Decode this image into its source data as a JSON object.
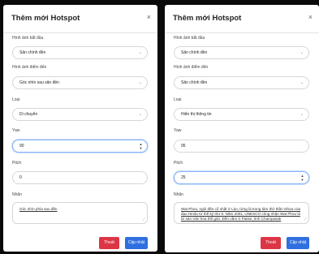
{
  "left_modal": {
    "title": "Thêm mới Hotspot",
    "close": "×",
    "fields": {
      "start_image_label": "Hình ảnh bắt đầu",
      "start_image_value": "Sân chính đền",
      "end_image_label": "Hình ảnh điểm đến",
      "end_image_value": "Góc nhìn sau sân đền",
      "type_label": "Loại",
      "type_value": "Di chuyển",
      "yaw_label": "Yaw",
      "yaw_value": "90",
      "pitch_label": "Pitch",
      "pitch_value": "0",
      "note_label": "Nhãn",
      "note_value": "Góc nhìn phía sau đền"
    },
    "buttons": {
      "cancel": "Thoát",
      "save": "Cập nhật"
    }
  },
  "right_modal": {
    "title": "Thêm mới Hotspot",
    "close": "×",
    "fields": {
      "start_image_label": "Hình ảnh bắt đầu",
      "start_image_value": "Sân chính đền",
      "end_image_label": "Hình ảnh điểm đến",
      "end_image_value": "Sân chính đền",
      "type_label": "Loại",
      "type_value": "Hiển thị thông tin",
      "yaw_label": "Yaw",
      "yaw_value": "95",
      "pitch_label": "Pitch",
      "pitch_value": "25",
      "note_label": "Nhãn",
      "note_value": "Wat Phou, ngôi đền cổ nhất ở Lào, từng là trung tâm thờ thần Shiva của đạo Hindu từ thế kỷ thứ 5. Năm 2001, UNESCO công nhận Wat Phou là Di sản Văn hóa thế giới. Đền nằm ở Pakse, tỉnh Champasak"
    },
    "buttons": {
      "cancel": "Thoát",
      "save": "Cập nhật"
    }
  },
  "icons": {
    "chevron": "chevron-down-icon",
    "spinner": "number-spinner-icon",
    "resize": "resize-handle-icon"
  },
  "colors": {
    "cancel": "#dc3545",
    "save": "#2f6fe0",
    "focus": "#8ab4f8"
  }
}
